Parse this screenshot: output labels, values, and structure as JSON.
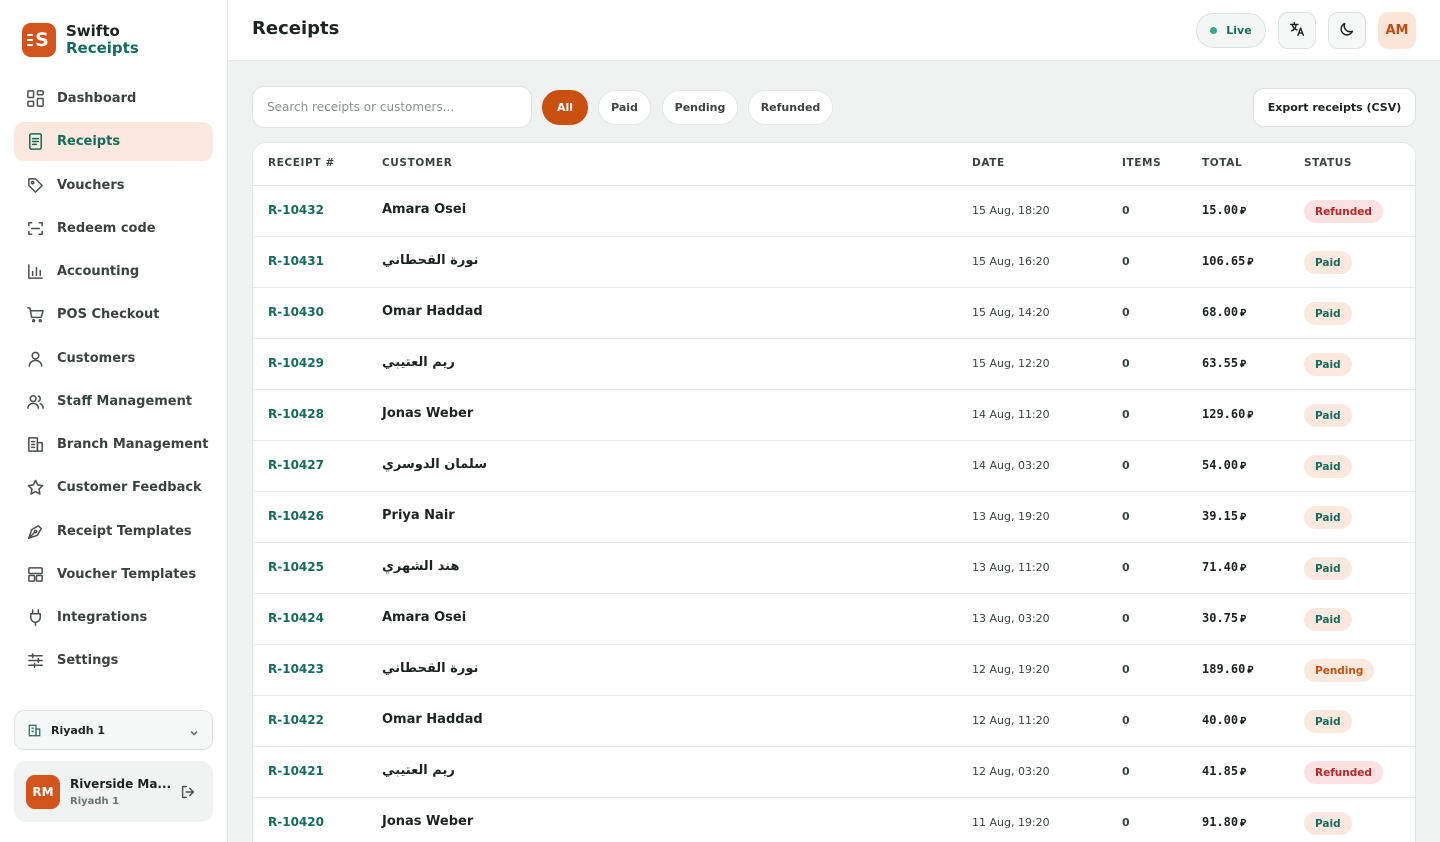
{
  "brand": {
    "logo_letter": "S",
    "name": "Swifto",
    "sub": "Receipts",
    "accent": "#d2531b",
    "primary": "#156b5c"
  },
  "sidebar": {
    "items": [
      {
        "label": "Dashboard",
        "icon": "dashboard-icon"
      },
      {
        "label": "Receipts",
        "icon": "receipt-icon",
        "active": true
      },
      {
        "label": "Vouchers",
        "icon": "tag-icon"
      },
      {
        "label": "Redeem code",
        "icon": "scan-icon"
      },
      {
        "label": "Accounting",
        "icon": "bar-chart-icon"
      },
      {
        "label": "POS Checkout",
        "icon": "cart-icon"
      },
      {
        "label": "Customers",
        "icon": "user-icon"
      },
      {
        "label": "Staff Management",
        "icon": "users-icon"
      },
      {
        "label": "Branch Management",
        "icon": "building-icon"
      },
      {
        "label": "Customer Feedback",
        "icon": "star-icon"
      },
      {
        "label": "Receipt Templates",
        "icon": "pen-tool-icon"
      },
      {
        "label": "Voucher Templates",
        "icon": "layout-icon"
      },
      {
        "label": "Integrations",
        "icon": "plug-icon"
      },
      {
        "label": "Settings",
        "icon": "sliders-icon"
      }
    ],
    "branch_selector": {
      "label": "Riyadh 1"
    },
    "user": {
      "initials": "RM",
      "name": "Riverside Ma...",
      "branch": "Riyadh 1"
    }
  },
  "header": {
    "title": "Receipts",
    "live_label": "Live",
    "avatar_initials": "AM"
  },
  "toolbar": {
    "search_placeholder": "Search receipts or customers...",
    "filters": [
      "All",
      "Paid",
      "Pending",
      "Refunded"
    ],
    "active_filter": "All",
    "export_label": "Export receipts (CSV)"
  },
  "table": {
    "columns": [
      "RECEIPT #",
      "CUSTOMER",
      "DATE",
      "ITEMS",
      "TOTAL",
      "STATUS"
    ],
    "currency_symbol": "⃁",
    "rows": [
      {
        "id": "R-10432",
        "customer": "Amara Osei",
        "date": "15 Aug, 18:20",
        "items": "0",
        "total": "15.00",
        "status": "Refunded"
      },
      {
        "id": "R-10431",
        "customer": "نورة القحطاني",
        "date": "15 Aug, 16:20",
        "items": "0",
        "total": "106.65",
        "status": "Paid"
      },
      {
        "id": "R-10430",
        "customer": "Omar Haddad",
        "date": "15 Aug, 14:20",
        "items": "0",
        "total": "68.00",
        "status": "Paid"
      },
      {
        "id": "R-10429",
        "customer": "ريم العتيبي",
        "date": "15 Aug, 12:20",
        "items": "0",
        "total": "63.55",
        "status": "Paid"
      },
      {
        "id": "R-10428",
        "customer": "Jonas Weber",
        "date": "14 Aug, 11:20",
        "items": "0",
        "total": "129.60",
        "status": "Paid"
      },
      {
        "id": "R-10427",
        "customer": "سلمان الدوسري",
        "date": "14 Aug, 03:20",
        "items": "0",
        "total": "54.00",
        "status": "Paid"
      },
      {
        "id": "R-10426",
        "customer": "Priya Nair",
        "date": "13 Aug, 19:20",
        "items": "0",
        "total": "39.15",
        "status": "Paid"
      },
      {
        "id": "R-10425",
        "customer": "هند الشهري",
        "date": "13 Aug, 11:20",
        "items": "0",
        "total": "71.40",
        "status": "Paid"
      },
      {
        "id": "R-10424",
        "customer": "Amara Osei",
        "date": "13 Aug, 03:20",
        "items": "0",
        "total": "30.75",
        "status": "Paid"
      },
      {
        "id": "R-10423",
        "customer": "نورة القحطاني",
        "date": "12 Aug, 19:20",
        "items": "0",
        "total": "189.60",
        "status": "Pending"
      },
      {
        "id": "R-10422",
        "customer": "Omar Haddad",
        "date": "12 Aug, 11:20",
        "items": "0",
        "total": "40.00",
        "status": "Paid"
      },
      {
        "id": "R-10421",
        "customer": "ريم العتيبي",
        "date": "12 Aug, 03:20",
        "items": "0",
        "total": "41.85",
        "status": "Refunded"
      },
      {
        "id": "R-10420",
        "customer": "Jonas Weber",
        "date": "11 Aug, 19:20",
        "items": "0",
        "total": "91.80",
        "status": "Paid"
      }
    ]
  }
}
